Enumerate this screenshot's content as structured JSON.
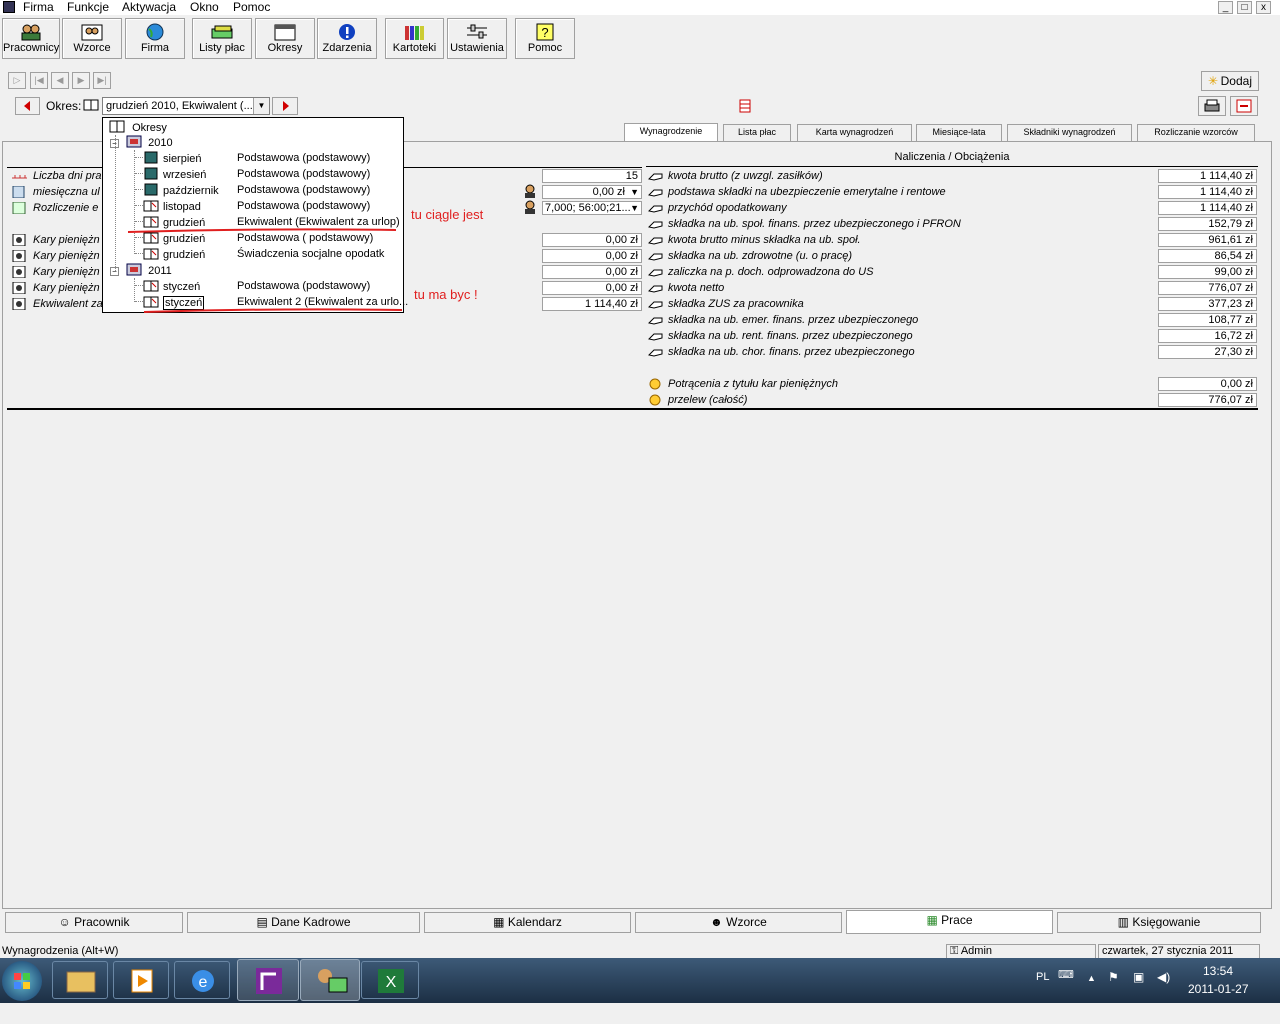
{
  "menubar": {
    "items": [
      "Firma",
      "Funkcje",
      "Aktywacja",
      "Okno",
      "Pomoc"
    ]
  },
  "window_controls": [
    "_",
    "□",
    "x"
  ],
  "toolbar": [
    {
      "label": "Pracownicy",
      "icon": "people-icon"
    },
    {
      "label": "Wzorce",
      "icon": "template-icon"
    },
    {
      "label": "Firma",
      "icon": "globe-icon"
    },
    {
      "label": "Listy płac",
      "icon": "money-icon"
    },
    {
      "label": "Okresy",
      "icon": "calendar-icon"
    },
    {
      "label": "Zdarzenia",
      "icon": "info-icon"
    },
    {
      "label": "Kartoteki",
      "icon": "books-icon"
    },
    {
      "label": "Ustawienia",
      "icon": "sliders-icon"
    },
    {
      "label": "Pomoc",
      "icon": "help-icon"
    }
  ],
  "record_nav": {
    "dodaj": "Dodaj"
  },
  "okres": {
    "label": "Okres:",
    "value": "grudzień 2010, Ekwiwalent (..."
  },
  "tabs": [
    "Wynagrodzenie",
    "Lista płac",
    "Karta wynagrodzeń",
    "Miesiące-lata",
    "Składniki wynagrodzeń",
    "Rozliczanie wzorców"
  ],
  "section_header": "Naliczenia / Obciążenia",
  "left_rows": [
    {
      "label": "Liczba dni pra",
      "value": "15"
    },
    {
      "label": "miesięczna ul",
      "value": "0,00 zł"
    },
    {
      "label": "Rozliczenie e",
      "value": "7,000; 56:00;21..."
    },
    {
      "label": "Kary pieniężn",
      "value": "0,00 zł"
    },
    {
      "label": "Kary pieniężn",
      "value": "0,00 zł"
    },
    {
      "label": "Kary pieniężn",
      "value": "0,00 zł"
    },
    {
      "label": "Kary pieniężn",
      "value": "0,00 zł"
    },
    {
      "label": "Ekwiwalent za",
      "value": "1 114,40 zł"
    }
  ],
  "right_rows": [
    {
      "label": "kwota brutto (z uwzgl. zasiłków)",
      "value": "1 114,40 zł"
    },
    {
      "label": "podstawa składki na ubezpieczenie emerytalne i rentowe",
      "value": "1 114,40 zł"
    },
    {
      "label": "przychód opodatkowany",
      "value": "1 114,40 zł"
    },
    {
      "label": "składka na ub. społ. finans. przez ubezpieczonego i PFRON",
      "value": "152,79 zł"
    },
    {
      "label": "kwota brutto minus składka na ub. społ.",
      "value": "961,61 zł"
    },
    {
      "label": "składka na ub. zdrowotne (u. o pracę)",
      "value": "86,54 zł"
    },
    {
      "label": "zaliczka na p. doch. odprowadzona do US",
      "value": "99,00 zł"
    },
    {
      "label": "kwota netto",
      "value": "776,07 zł"
    },
    {
      "label": "składka ZUS za pracownika",
      "value": "377,23 zł"
    },
    {
      "label": "składka na ub. emer. finans. przez ubezpieczonego",
      "value": "108,77 zł"
    },
    {
      "label": "składka na ub. rent. finans. przez ubezpieczonego",
      "value": "16,72 zł"
    },
    {
      "label": "składka na ub. chor. finans. przez ubezpieczonego",
      "value": "27,30 zł"
    }
  ],
  "right_extra": [
    {
      "label": "Potrącenia z tytułu kar pieniężnych",
      "value": "0,00 zł"
    },
    {
      "label": "przelew (całość)",
      "value": "776,07 zł"
    }
  ],
  "tree": {
    "root": "Okresy",
    "years": [
      {
        "year": "2010",
        "items": [
          {
            "month": "sierpień",
            "desc": "Podstawowa (podstawowy)"
          },
          {
            "month": "wrzesień",
            "desc": "Podstawowa (podstawowy)"
          },
          {
            "month": "październik",
            "desc": "Podstawowa (podstawowy)"
          },
          {
            "month": "listopad",
            "desc": "Podstawowa (podstawowy)"
          },
          {
            "month": "grudzień",
            "desc": "Ekwiwalent (Ekwiwalent za urlop)"
          },
          {
            "month": "grudzień",
            "desc": "Podstawowa ( podstawowy)"
          },
          {
            "month": "grudzień",
            "desc": "Świadczenia socjalne opodatk"
          }
        ]
      },
      {
        "year": "2011",
        "items": [
          {
            "month": "styczeń",
            "desc": "Podstawowa (podstawowy)"
          },
          {
            "month": "styczeń",
            "desc": "Ekwiwalent 2 (Ekwiwalent za urlo..."
          }
        ]
      }
    ]
  },
  "annotations": [
    "tu ciągle jest",
    "tu ma byc !"
  ],
  "bottom_tabs": [
    "Pracownik",
    "Dane Kadrowe",
    "Kalendarz",
    "Wzorce",
    "Prace",
    "Księgowanie"
  ],
  "status": {
    "left": "Wynagrodzenia (Alt+W)",
    "user": "Admin",
    "date": "czwartek, 27 stycznia 2011"
  },
  "taskbar": {
    "lang": "PL",
    "time": "13:54",
    "date": "2011-01-27"
  },
  "colors": {
    "annotation": "#e02020",
    "arrow_red": "#d00000"
  }
}
